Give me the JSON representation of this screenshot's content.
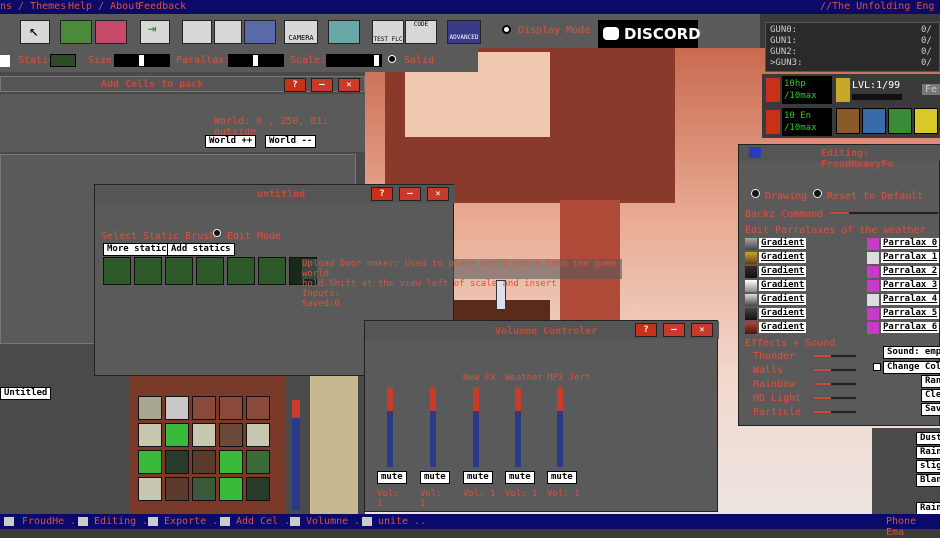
{
  "menubar": {
    "items": [
      "ns / Themes",
      "Help / About",
      "Feedback"
    ],
    "right_title": "//The Unfolding Eng"
  },
  "toolbar": {
    "camera": "CAMERA",
    "test_flc": "TEST FLC",
    "code": "CODE",
    "advanced": "ADVANCED",
    "display_mode_label": "Display Mode",
    "discord": "DISCORD"
  },
  "guns": {
    "rows": [
      "GUN0:",
      "GUN1:",
      "GUN2:",
      ">GUN3:"
    ],
    "values": [
      "0/",
      "0/",
      "0/",
      "0/"
    ]
  },
  "hud": {
    "hp": "10hp",
    "hp_max": "/10max",
    "en": "10 En",
    "en_max": "/10max",
    "level": "LVL:1/99",
    "fe": "Fe"
  },
  "statics_bar": {
    "static_label": "Static:",
    "size_label": "Size:",
    "parallax_label": "Parallax:",
    "scale_label": "Scale:",
    "solid_label": "Solid"
  },
  "add_cells": {
    "title": "Add Cells to pack",
    "world_info": "World: 0 , 250, 81: outside",
    "world_plus": "World ++",
    "world_minus": "World --"
  },
  "untitled": {
    "title": "untitled",
    "select_label": "Select Static Brush",
    "edit_mode": "Edit Mode",
    "more_statics": "More statics",
    "add_statics": "Add statics",
    "tooltip": [
      "Upload Door maker: Used to place world doors into the game world",
      "hold Shift at the view left of scale and insert",
      "Inputs:",
      "Saved:0"
    ]
  },
  "volume": {
    "title": "Volumne Controler",
    "channels": [
      "",
      "",
      "New FX",
      "Weather",
      "MP3 Jert"
    ],
    "mute": "mute",
    "vol_label": "Vol: 1"
  },
  "editing": {
    "title": "Editing: FroudHeavyFo",
    "opt1": "Drawing",
    "opt2": "Reset to Default",
    "lock_label": "Backz Command",
    "parallax_header": "Edit Parralaxes of the weather",
    "gradient": "Gradient",
    "parallax_items": [
      "Parralax 0",
      "Parralax 1",
      "Parralax 2",
      "Parralax 3",
      "Parralax 4",
      "Parralax 5",
      "Parralax 6"
    ],
    "effects_header": "Effects + Sound",
    "effects": [
      "Thunder",
      "Walls",
      "Rainbow",
      "HD Light",
      "Particle"
    ],
    "sound": "Sound: empty",
    "change_color": "Change Color",
    "side": [
      "Rand",
      "Clea",
      "Save"
    ]
  },
  "right_list": [
    "Dust",
    "Rain",
    "slight",
    "Blank",
    "Rainb"
  ],
  "left_panel": {
    "untitled": "Untitled"
  },
  "taskbar": {
    "items": [
      "FroudHe ..",
      "Editing ..",
      "Exporte ..",
      "Add Cel ..",
      "Volumne ..",
      "unite .."
    ],
    "right": "Phone Ema"
  }
}
